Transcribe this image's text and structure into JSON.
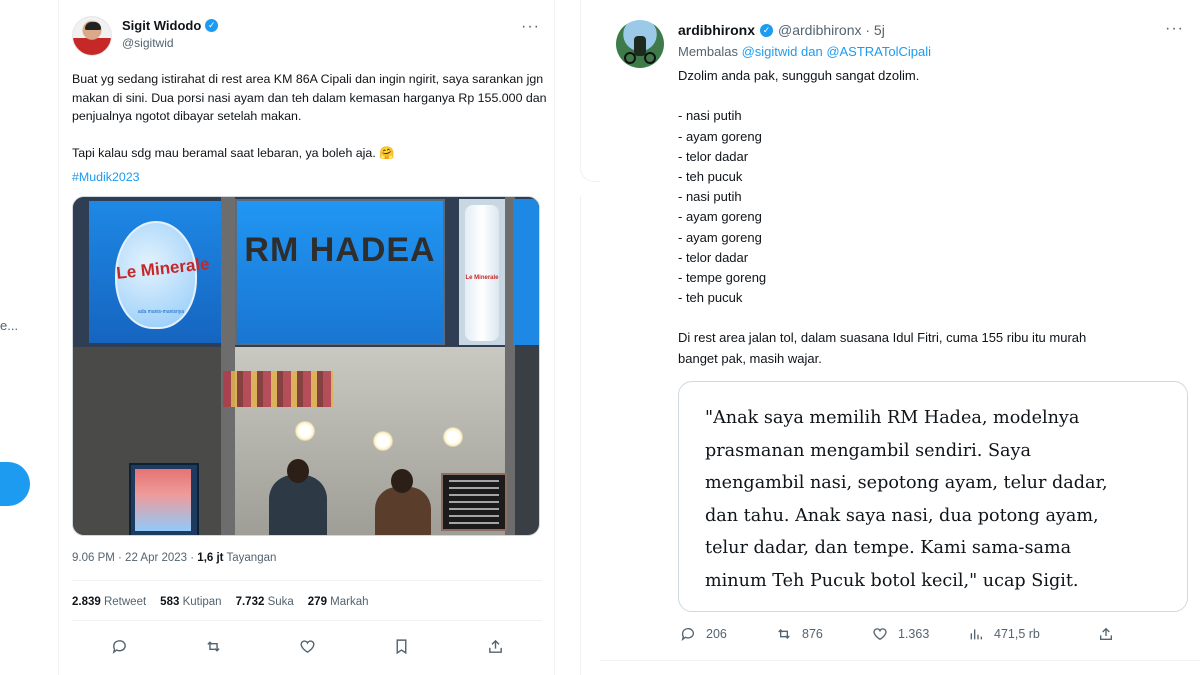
{
  "left_edge": {
    "text": "e..."
  },
  "tweet1": {
    "author_name": "Sigit Widodo",
    "author_handle": "@sigitwid",
    "more": "···",
    "paragraph1": "Buat yg sedang istirahat di rest area KM 86A Cipali dan ingin ngirit, saya sarankan jgn makan di sini. Dua porsi nasi ayam dan teh dalam kemasan harganya Rp 155.000 dan penjualnya ngotot dibayar setelah makan.",
    "paragraph2": "Tapi kalau sdg mau beramal saat lebaran, ya boleh aja. 🤗",
    "hashtag": "#Mudik2023",
    "photo": {
      "sign_left": "Le Minerale",
      "sign_left_sub": "ada manis-manisnya",
      "sign_center": "RM HADEA",
      "bottle_label": "Le Minerale"
    },
    "timestamp": "9.06 PM · 22 Apr 2023 · ",
    "views_count": "1,6 jt",
    "views_label": " Tayangan",
    "stats": {
      "retweets_count": "2.839",
      "retweets_label": "Retweet",
      "quotes_count": "583",
      "quotes_label": "Kutipan",
      "likes_count": "7.732",
      "likes_label": "Suka",
      "bookmarks_count": "279",
      "bookmarks_label": "Markah"
    },
    "action_icons": [
      "reply-icon",
      "retweet-icon",
      "like-icon",
      "bookmark-icon",
      "share-icon"
    ]
  },
  "tweet2": {
    "author_name": "ardibhironx",
    "author_handle": "@ardibhironx · 5j",
    "more": "···",
    "reply_prefix": "Membalas ",
    "reply_to": "@sigitwid dan @ASTRATolCipali",
    "opening": "Dzolim anda pak, sungguh sangat dzolim.",
    "list": [
      "- nasi putih",
      "- ayam goreng",
      "- telor dadar",
      "- teh pucuk",
      "- nasi putih",
      "- ayam goreng",
      "- ayam goreng",
      "- telor dadar",
      "- tempe goreng",
      "- teh pucuk"
    ],
    "closing_line1": "Di rest area jalan tol, dalam suasana Idul Fitri, cuma 155 ribu itu murah",
    "closing_line2": "banget pak, masih wajar.",
    "quote_lines": [
      "\"Anak saya memilih RM Hadea, modelnya",
      "prasmanan mengambil sendiri. Saya",
      "mengambil nasi, sepotong ayam, telur dadar,",
      "dan tahu. Anak saya nasi, dua potong ayam,",
      "telur dadar, dan tempe. Kami sama-sama",
      "minum Teh Pucuk botol kecil,\" ucap Sigit."
    ],
    "actions": {
      "replies": "206",
      "retweets": "876",
      "likes": "1.363",
      "views": "471,5 rb"
    }
  },
  "colors": {
    "accent": "#1d9bf0",
    "text_primary": "#0f1419",
    "text_secondary": "#536471",
    "border": "#cfd9de"
  }
}
